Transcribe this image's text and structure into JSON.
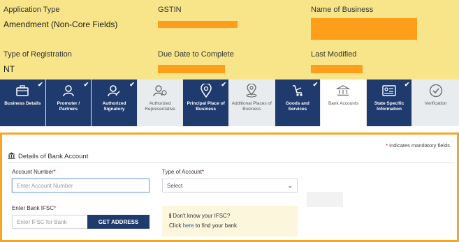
{
  "header": {
    "application_type": {
      "label": "Application Type",
      "value": "Amendment (Non-Core Fields)"
    },
    "gstin": {
      "label": "GSTIN"
    },
    "name_of_business": {
      "label": "Name of Business"
    },
    "type_of_registration": {
      "label": "Type of Registration",
      "value": "NT"
    },
    "due_date": {
      "label": "Due Date to Complete"
    },
    "last_modified": {
      "label": "Last Modified"
    },
    "redaction_color": "#ff9e1b",
    "panel_color": "#f8e58a"
  },
  "tabs": [
    {
      "label": "Business Details",
      "icon": "briefcase-icon",
      "state": "done"
    },
    {
      "label": "Promoter / Partners",
      "icon": "person-icon",
      "state": "done"
    },
    {
      "label": "Authorized Signatory",
      "icon": "signatory-icon",
      "state": "done"
    },
    {
      "label": "Authorized Representative",
      "icon": "representative-icon",
      "state": "pending"
    },
    {
      "label": "Principal Place of Business",
      "icon": "location-pin-icon",
      "state": "done"
    },
    {
      "label": "Additional Places of Business",
      "icon": "additional-location-icon",
      "state": "pending"
    },
    {
      "label": "Goods and Services",
      "icon": "goods-services-icon",
      "state": "done"
    },
    {
      "label": "Bank Accounts",
      "icon": "bank-icon",
      "state": "active"
    },
    {
      "label": "State Specific Information",
      "icon": "id-card-icon",
      "state": "done"
    },
    {
      "label": "Verification",
      "icon": "verification-check-icon",
      "state": "pending"
    }
  ],
  "colors": {
    "tab_done": "#1f3b6e",
    "accent_border": "#f5a623",
    "mandatory_star": "#d0021b"
  },
  "form": {
    "mandatory_note": "indicates mandatory fields",
    "section_title": "Details of Bank Account",
    "account_number": {
      "label": "Account Number",
      "placeholder": "Enter Account Number"
    },
    "type_of_account": {
      "label": "Type of Account",
      "selected": "Select"
    },
    "bank_ifsc": {
      "label": "Enter Bank IFSC",
      "placeholder": "Enter IFSC for Bank"
    },
    "get_address_button": "GET ADDRESS",
    "ifsc_help": {
      "question": "Don't know your IFSC?",
      "prefix": "Click",
      "link": "here",
      "suffix": "to find your bank"
    }
  }
}
